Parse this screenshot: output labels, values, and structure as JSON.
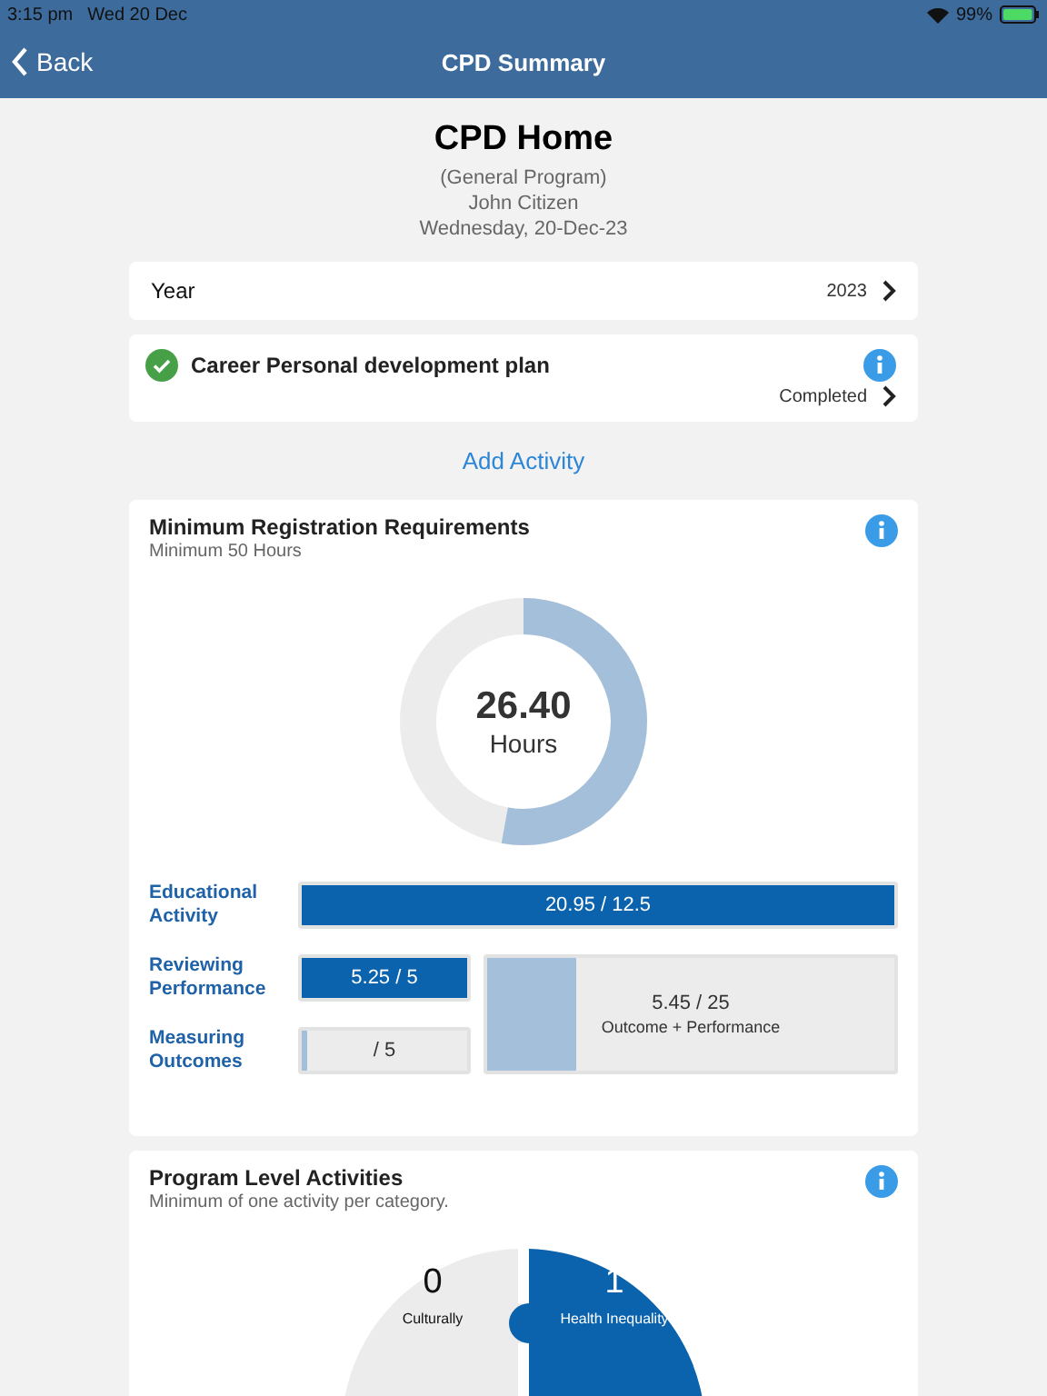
{
  "status_bar": {
    "time": "3:15 pm",
    "date": "Wed 20 Dec",
    "battery": "99%"
  },
  "nav": {
    "back": "Back",
    "title": "CPD Summary"
  },
  "header": {
    "title": "CPD Home",
    "program": "(General Program)",
    "name": "John Citizen",
    "date": "Wednesday, 20-Dec-23"
  },
  "year_row": {
    "label": "Year",
    "value": "2023"
  },
  "plan": {
    "title": "Career Personal development plan",
    "status": "Completed",
    "checked": true
  },
  "add_activity": "Add Activity",
  "registration": {
    "title": "Minimum Registration Requirements",
    "subtitle": "Minimum 50 Hours",
    "total": "26.40",
    "unit": "Hours",
    "level": 0.528,
    "bars": [
      {
        "label": "Educational Activity",
        "reading": "20.95 / 12.5",
        "level": 1
      },
      {
        "label": "Reviewing Performance",
        "reading": "5.25 / 5",
        "level": 1
      },
      {
        "label": "Measuring Outcomes",
        "reading": "/ 5",
        "level": 0.03
      }
    ],
    "combined": {
      "reading": "5.45 / 25",
      "caption": "Outcome + Performance",
      "level": 0.218
    }
  },
  "program_level": {
    "title": "Program Level Activities",
    "subtitle": "Minimum of one activity per category.",
    "pieces": [
      {
        "count": "0",
        "label": "Culturally",
        "color": "#ececec"
      },
      {
        "count": "1",
        "label": "Health Inequality",
        "color": "#0b63ad"
      }
    ]
  }
}
